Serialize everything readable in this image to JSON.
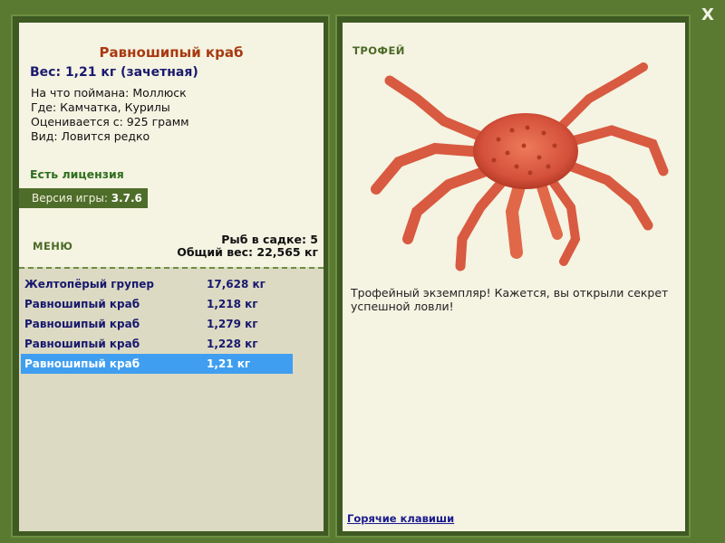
{
  "close_label": "X",
  "fish": {
    "name": "Равношипый краб",
    "weight": "Вес: 1,21 кг (зачетная)",
    "bait": "На что поймана: Моллюск",
    "location": "Где: Камчатка, Курилы",
    "threshold": "Оценивается с: 925 грамм",
    "rarity": "Вид: Ловится редко"
  },
  "license": "Есть лицензия",
  "version": {
    "label": "Версия игры:",
    "value": "3.7.6"
  },
  "menu_label": "МЕНЮ",
  "keepnet": {
    "count": "Рыб в садке: 5",
    "total_weight": "Общий вес: 22,565 кг"
  },
  "catch_list": [
    {
      "name": "Желтопёрый групер",
      "weight": "17,628 кг"
    },
    {
      "name": "Равношипый краб",
      "weight": "1,218 кг"
    },
    {
      "name": "Равношипый краб",
      "weight": "1,279 кг"
    },
    {
      "name": "Равношипый краб",
      "weight": "1,228 кг"
    },
    {
      "name": "Равношипый краб",
      "weight": "1,21 кг"
    }
  ],
  "selected_index": 4,
  "trophy": {
    "label": "ТРОФЕЙ",
    "text": "Трофейный экземпляр! Кажется, вы открыли секрет успешной ловли!"
  },
  "hotkeys_link": "Горячие клавиши",
  "colors": {
    "background": "#5a7a32",
    "panel": "#f5f3e2",
    "list_bg": "#dcdac2",
    "selected_row": "#3f9ef0",
    "fish_name": "#a83a10",
    "crab": "#d9503a"
  },
  "icons": {
    "close": "close-icon",
    "trophy_image": "king-crab-image"
  }
}
